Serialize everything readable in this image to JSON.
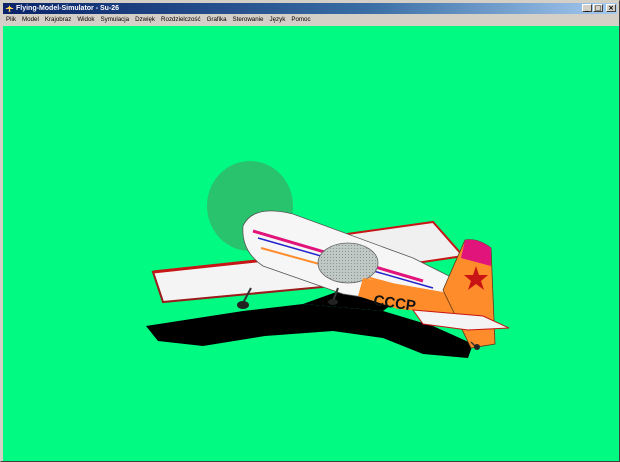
{
  "window": {
    "title": "Flying-Model-Simulator - Su-26",
    "controls": {
      "minimize": "_",
      "maximize": "□",
      "close": "×"
    }
  },
  "menu": [
    {
      "label": "Plik"
    },
    {
      "label": "Model"
    },
    {
      "label": "Krajobraz"
    },
    {
      "label": "Widok"
    },
    {
      "label": "Symulacja"
    },
    {
      "label": "Dzwięk"
    },
    {
      "label": "Rozdzielczość"
    },
    {
      "label": "Grafika"
    },
    {
      "label": "Sterowanie"
    },
    {
      "label": "Język"
    },
    {
      "label": "Pomoc"
    }
  ],
  "viewport": {
    "background": "#00fa82",
    "aircraft": {
      "model": "Su-26",
      "registration": "CCCP",
      "colors": {
        "body": "#f4f4f4",
        "orange": "#ff8c2a",
        "magenta": "#e0147a",
        "red": "#c81414",
        "blue": "#2222cc"
      }
    }
  }
}
